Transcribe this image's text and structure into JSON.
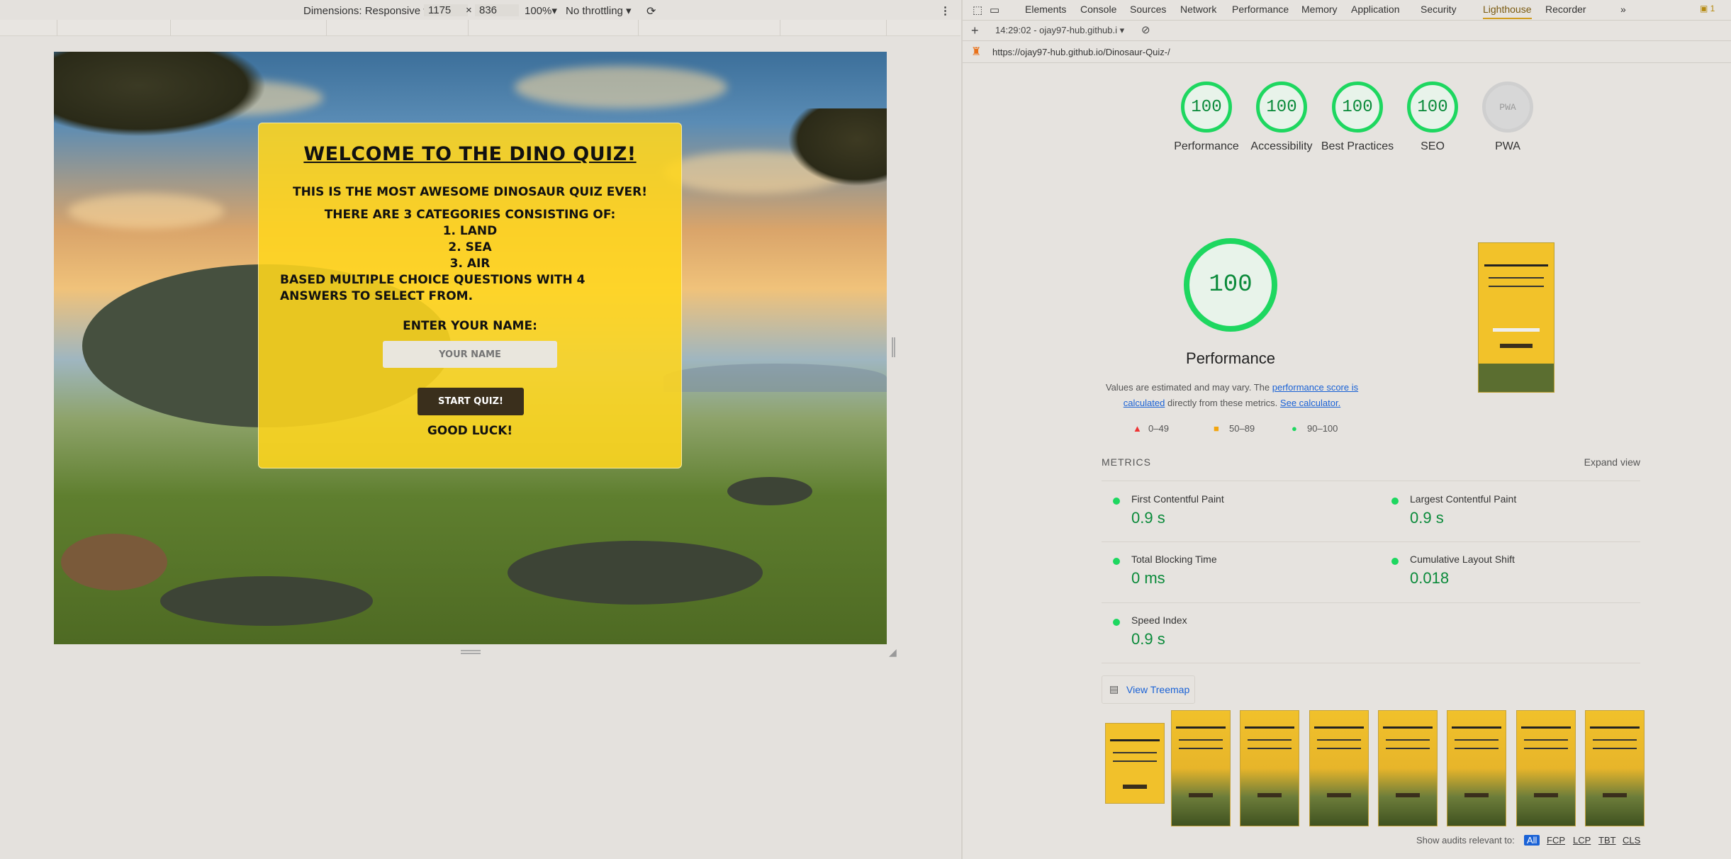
{
  "device_toolbar": {
    "dimensions_label": "Dimensions: Responsive",
    "width": "1175",
    "times": "×",
    "height": "836",
    "zoom": "100%",
    "throttling": "No throttling"
  },
  "quiz": {
    "title": "Welcome to the Dino Quiz!",
    "tagline": "This is the most awesome dinosaur quiz ever!",
    "categories_intro": "There are 3 categories consisting of:",
    "categories": [
      "1. Land",
      "2. Sea",
      "3. Air"
    ],
    "description": "Based multiple choice questions with 4 answers to select from.",
    "name_label": "Enter your name:",
    "name_placeholder": "Your Name",
    "start_button": "Start Quiz!",
    "good_luck": "Good luck!"
  },
  "devtools": {
    "tabs": [
      "Elements",
      "Console",
      "Sources",
      "Network",
      "Performance",
      "Memory",
      "Application",
      "Security",
      "Lighthouse",
      "Recorder"
    ],
    "active_tab": "Lighthouse",
    "more_tabs": "»",
    "issues_count": "1",
    "report_selector": "14:29:02 - ojay97-hub.github.i",
    "url": "https://ojay97-hub.github.io/Dinosaur-Quiz-/"
  },
  "lighthouse": {
    "scores": [
      {
        "label": "Performance",
        "value": "100"
      },
      {
        "label": "Accessibility",
        "value": "100"
      },
      {
        "label": "Best Practices",
        "value": "100"
      },
      {
        "label": "SEO",
        "value": "100"
      },
      {
        "label": "PWA",
        "value": "PWA"
      }
    ],
    "big_score": "100",
    "big_label": "Performance",
    "note_prefix": "Values are estimated and may vary. The",
    "note_link": "performance score is calculated",
    "note_middle": "directly from these metrics.",
    "note_calc": "See calculator.",
    "legend": [
      "0–49",
      "50–89",
      "90–100"
    ],
    "metrics_header": "METRICS",
    "expand_view": "Expand view",
    "metrics": [
      {
        "label": "First Contentful Paint",
        "value": "0.9 s"
      },
      {
        "label": "Largest Contentful Paint",
        "value": "0.9 s"
      },
      {
        "label": "Total Blocking Time",
        "value": "0 ms"
      },
      {
        "label": "Cumulative Layout Shift",
        "value": "0.018"
      },
      {
        "label": "Speed Index",
        "value": "0.9 s"
      }
    ],
    "treemap_label": "View Treemap",
    "audits_prefix": "Show audits relevant to:",
    "audit_filters": [
      "All",
      "FCP",
      "LCP",
      "TBT",
      "CLS"
    ]
  },
  "colors": {
    "pass_green": "#1ed760",
    "card_yellow": "#ffd61e",
    "link_blue": "#1a62d6"
  }
}
